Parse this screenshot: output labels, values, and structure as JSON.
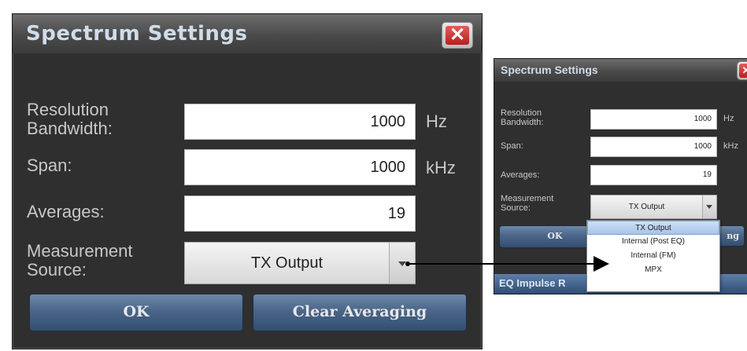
{
  "large_dialog": {
    "title": "Spectrum Settings",
    "close_glyph": "✕",
    "resolution_label_1": "Resolution",
    "resolution_label_2": "Bandwidth:",
    "resolution_value": "1000",
    "resolution_unit": "Hz",
    "span_label": "Span:",
    "span_value": "1000",
    "span_unit": "kHz",
    "averages_label": "Averages:",
    "averages_value": "19",
    "source_label_1": "Measurement",
    "source_label_2": "Source:",
    "source_value": "TX Output",
    "ok_label": "OK",
    "clear_label": "Clear Averaging"
  },
  "small_dialog": {
    "title": "Spectrum Settings",
    "close_glyph": "✕",
    "resolution_label_1": "Resolution",
    "resolution_label_2": "Bandwidth:",
    "resolution_value": "1000",
    "resolution_unit": "Hz",
    "span_label": "Span:",
    "span_value": "1000",
    "span_unit": "kHz",
    "averages_label": "Averages:",
    "averages_value": "19",
    "source_label_1": "Measurement",
    "source_label_2": "Source:",
    "source_value": "TX Output",
    "ok_label": "OK",
    "clear_label_partial": "ng",
    "sub_title": "EQ Impulse R"
  },
  "dropdown_options": [
    "TX Output",
    "Internal (Post EQ)",
    "Internal (FM)",
    "MPX"
  ],
  "icons": {
    "close": "close-icon",
    "dropdown": "chevron-down-icon"
  },
  "colors": {
    "dialog_bg": "#2f2f2f",
    "button_blue": "#4a6688",
    "close_red": "#c83030"
  }
}
